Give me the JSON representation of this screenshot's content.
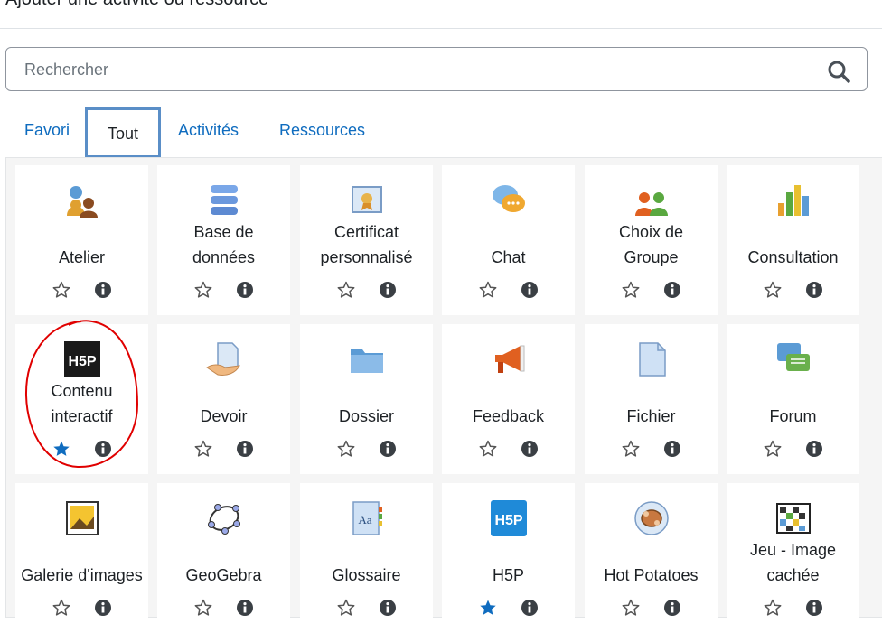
{
  "header": {
    "title": "Ajouter une activité ou ressource"
  },
  "search": {
    "placeholder": "Rechercher"
  },
  "tabs": [
    {
      "label": "Favori"
    },
    {
      "label": "Tout"
    },
    {
      "label": "Activités"
    },
    {
      "label": "Ressources"
    }
  ],
  "colors": {
    "link": "#0f6cbf",
    "active_tab_border": "#5a8ec7",
    "starred": "#0f6cbf",
    "annotation": "#e00000"
  },
  "modules": [
    {
      "label1": "",
      "label2": "Atelier",
      "icon": "workshop-icon",
      "starred": false
    },
    {
      "label1": "Base de",
      "label2": "données",
      "icon": "database-icon",
      "starred": false
    },
    {
      "label1": "Certificat",
      "label2": "personnalisé",
      "icon": "certificate-icon",
      "starred": false
    },
    {
      "label1": "",
      "label2": "Chat",
      "icon": "chat-icon",
      "starred": false
    },
    {
      "label1": "Choix de",
      "label2": "Groupe",
      "icon": "group-choice-icon",
      "starred": false
    },
    {
      "label1": "",
      "label2": "Consultation",
      "icon": "survey-chart-icon",
      "starred": false
    },
    {
      "label1": "Contenu",
      "label2": "interactif",
      "icon": "h5p-black-icon",
      "starred": true
    },
    {
      "label1": "",
      "label2": "Devoir",
      "icon": "assignment-icon",
      "starred": false
    },
    {
      "label1": "",
      "label2": "Dossier",
      "icon": "folder-icon",
      "starred": false
    },
    {
      "label1": "",
      "label2": "Feedback",
      "icon": "megaphone-icon",
      "starred": false
    },
    {
      "label1": "",
      "label2": "Fichier",
      "icon": "file-icon",
      "starred": false
    },
    {
      "label1": "",
      "label2": "Forum",
      "icon": "forum-icon",
      "starred": false
    },
    {
      "label1": "",
      "label2": "Galerie d'images",
      "icon": "image-gallery-icon",
      "starred": false
    },
    {
      "label1": "",
      "label2": "GeoGebra",
      "icon": "geogebra-icon",
      "starred": false
    },
    {
      "label1": "",
      "label2": "Glossaire",
      "icon": "glossary-icon",
      "starred": false
    },
    {
      "label1": "",
      "label2": "H5P",
      "icon": "h5p-blue-icon",
      "starred": true
    },
    {
      "label1": "",
      "label2": "Hot Potatoes",
      "icon": "hot-potatoes-icon",
      "starred": false
    },
    {
      "label1": "Jeu - Image",
      "label2": "cachée",
      "icon": "hidden-picture-icon",
      "starred": false
    }
  ]
}
